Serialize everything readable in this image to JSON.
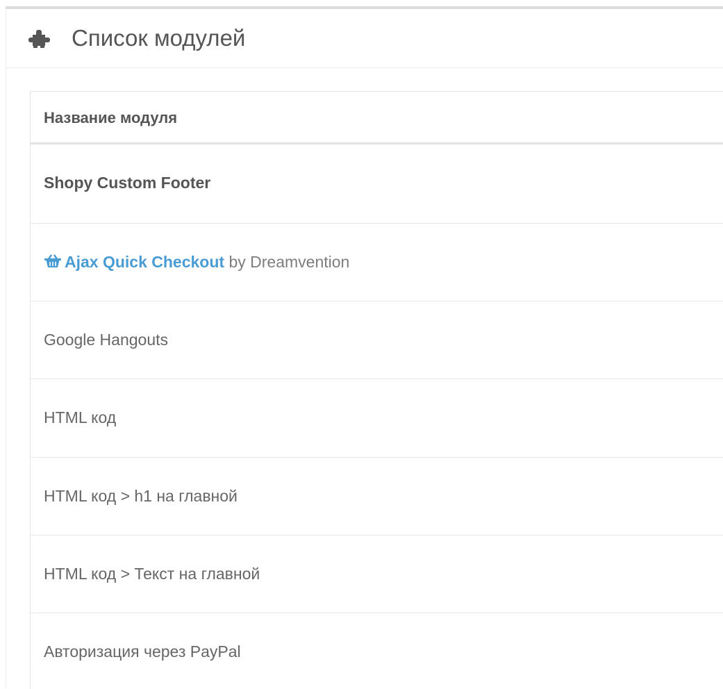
{
  "panel": {
    "title": "Список модулей",
    "icon": "puzzle-icon"
  },
  "table": {
    "header": "Название модуля",
    "rows": [
      {
        "name": "Shopy Custom Footer"
      },
      {
        "name": "Ajax Quick Checkout",
        "suffix": " by Dreamvention",
        "icon": "basket-icon"
      },
      {
        "name": "Google Hangouts"
      },
      {
        "name": "HTML код"
      },
      {
        "name": "HTML код > h1 на главной"
      },
      {
        "name": "HTML код > Текст на главной"
      },
      {
        "name": "Авторизация через PayPal"
      }
    ]
  },
  "colors": {
    "link": "#4a9cd4",
    "text": "#555555",
    "border": "#e6e6e6"
  }
}
